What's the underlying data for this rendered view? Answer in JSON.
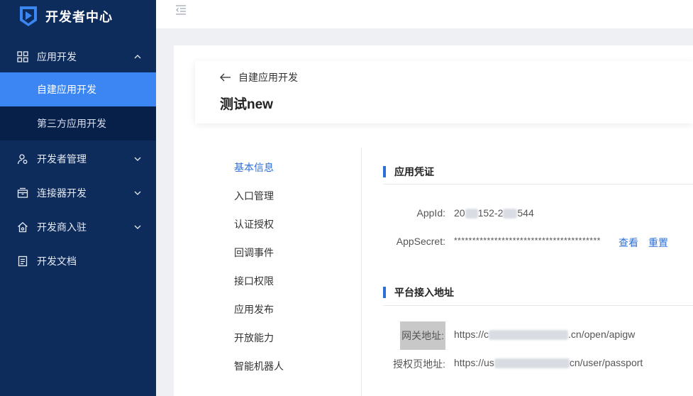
{
  "app": {
    "title": "开发者中心"
  },
  "sidebar": {
    "items": [
      {
        "label": "应用开发",
        "icon": "grid-icon",
        "expanded": true,
        "children": [
          {
            "label": "自建应用开发",
            "active": true
          },
          {
            "label": "第三方应用开发",
            "active": false
          }
        ]
      },
      {
        "label": "开发者管理",
        "icon": "user-gear-icon"
      },
      {
        "label": "连接器开发",
        "icon": "box-icon"
      },
      {
        "label": "开发商入驻",
        "icon": "house-icon"
      },
      {
        "label": "开发文档",
        "icon": "doc-icon"
      }
    ]
  },
  "header": {
    "back_label": "自建应用开发",
    "title": "测试new"
  },
  "nav": {
    "items": [
      "基本信息",
      "入口管理",
      "认证授权",
      "回调事件",
      "接口权限",
      "应用发布",
      "开放能力",
      "智能机器人"
    ],
    "active_index": 0
  },
  "credentials": {
    "section_title": "应用凭证",
    "appid_label": "AppId:",
    "appid_prefix": "20",
    "appid_mid": "152-2",
    "appid_suffix": "544",
    "secret_label": "AppSecret:",
    "secret_value": "****************************************",
    "view_label": "查看",
    "reset_label": "重置"
  },
  "platform": {
    "section_title": "平台接入地址",
    "gateway_label": "网关地址:",
    "gateway_prefix": "https://c",
    "gateway_suffix": ".cn/open/apigw",
    "auth_label": "授权页地址:",
    "auth_prefix": "https://us",
    "auth_suffix": "cn/user/passport"
  },
  "colors": {
    "sidebar_bg": "#0d2b5b",
    "active": "#3b86f2",
    "accent": "#2e6fd6"
  }
}
